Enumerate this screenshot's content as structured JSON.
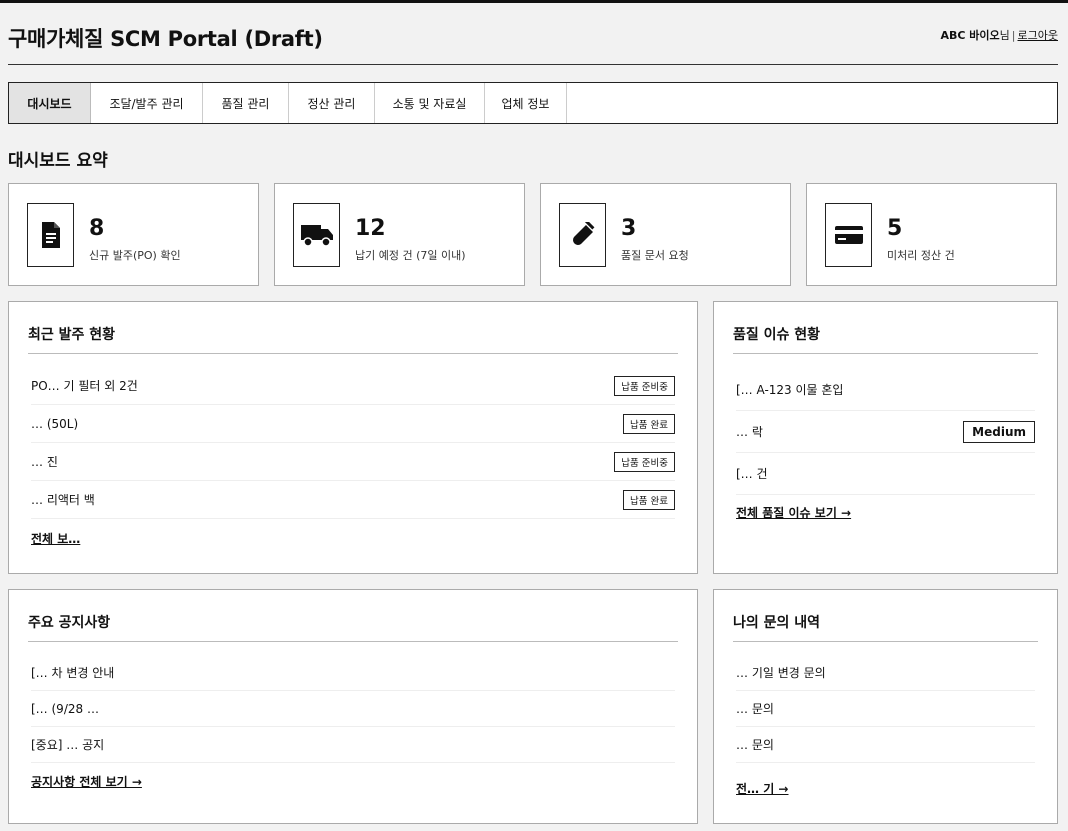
{
  "app": {
    "title": "구매가체질 SCM Portal (Draft)",
    "user_name": "ABC 바이오",
    "user_suffix": "님",
    "separator": "|",
    "logout_label": "로그아웃"
  },
  "nav": {
    "tabs": [
      {
        "label": "대시보드",
        "active": true
      },
      {
        "label": "조달/발주 관리"
      },
      {
        "label": "품질 관리"
      },
      {
        "label": "정산 관리"
      },
      {
        "label": "소통 및 자료실"
      },
      {
        "label": "업체 정보"
      }
    ]
  },
  "dashboard": {
    "title": "대시보드 요약",
    "stats": [
      {
        "value": "8",
        "label": "신규 발주(PO) 확인",
        "icon": "document-icon"
      },
      {
        "value": "12",
        "label": "납기 예정 건 (7일 이내)",
        "icon": "truck-icon"
      },
      {
        "value": "3",
        "label": "품질 문서 요청",
        "icon": "test-tube-icon"
      },
      {
        "value": "5",
        "label": "미처리 정산 건",
        "icon": "credit-card-icon"
      }
    ]
  },
  "recent_orders": {
    "title": "최근 발주 현황",
    "rows": [
      {
        "text": "PO… 기 필터 외 2건",
        "status": "납품 준비중"
      },
      {
        "text": "… (50L)",
        "status": "납품 완료"
      },
      {
        "text": "… 진",
        "status": "납품 준비중"
      },
      {
        "text": "… 리액터 백",
        "status": "납품 완료"
      }
    ],
    "view_all": "전체 보…"
  },
  "quality_issues": {
    "title": "품질 이슈 현황",
    "rows": [
      {
        "text": "[… A-123 이물 혼입",
        "level": ""
      },
      {
        "text": "… 락",
        "level": "Medium"
      },
      {
        "text": "[… 건",
        "level": ""
      }
    ],
    "view_all": "전체 품질 이슈 보기 →"
  },
  "notices": {
    "title": "주요 공지사항",
    "rows": [
      {
        "text": "[… 차 변경 안내",
        "date": ""
      },
      {
        "text": "[… (9/28 …",
        "date": ""
      },
      {
        "text": "[중요] … 공지",
        "date": ""
      }
    ],
    "view_all": "공지사항 전체 보기 →"
  },
  "my_inquiries": {
    "title": "나의 문의 내역",
    "rows": [
      {
        "text": "… 기일 변경 문의",
        "status": ""
      },
      {
        "text": "… 문의",
        "status": ""
      },
      {
        "text": "… 문의",
        "status": ""
      }
    ],
    "view_all": "전… 기 →"
  }
}
